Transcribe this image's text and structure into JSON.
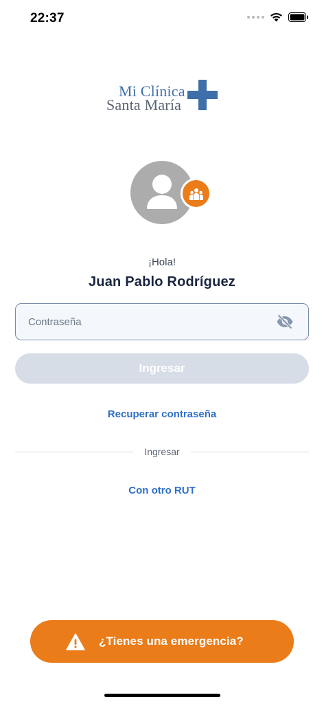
{
  "status_bar": {
    "time": "22:37",
    "icons": [
      "signal-dots-icon",
      "wifi-icon",
      "battery-icon"
    ]
  },
  "logo": {
    "line1": "Mi Clínica",
    "line2": "Santa María",
    "icon": "cross-icon",
    "colors": {
      "blue": "#3f6fa8",
      "gray": "#5a6474"
    }
  },
  "profile": {
    "avatar_icon": "user-icon",
    "badge_icon": "family-icon",
    "badge_color": "#ea7c1a",
    "greeting": "¡Hola!",
    "name": "Juan Pablo Rodríguez"
  },
  "password": {
    "value": "",
    "placeholder": "Contraseña",
    "toggle_icon": "eye-off-icon"
  },
  "actions": {
    "submit_label": "Ingresar",
    "recover_label": "Recuperar contraseña",
    "divider_label": "Ingresar",
    "other_rut_label": "Con otro RUT"
  },
  "emergency": {
    "label": "¿Tienes una emergencia?",
    "icon": "warning-icon",
    "color": "#ea7c1a"
  },
  "colors": {
    "link": "#2f6fc6",
    "disabled_button": "#d7dde6"
  }
}
